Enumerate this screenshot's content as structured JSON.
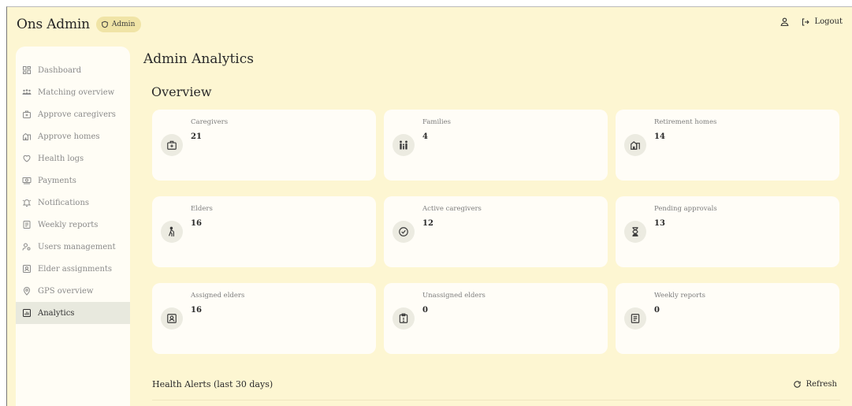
{
  "app": {
    "title": "Ons Admin",
    "role_badge": "Admin"
  },
  "topbar": {
    "logout_label": "Logout"
  },
  "sidebar": {
    "items": [
      {
        "label": "Dashboard",
        "icon": "dashboard-icon",
        "active": false
      },
      {
        "label": "Matching overview",
        "icon": "people-icon",
        "active": false
      },
      {
        "label": "Approve caregivers",
        "icon": "medical-case-icon",
        "active": false
      },
      {
        "label": "Approve homes",
        "icon": "building-icon",
        "active": false
      },
      {
        "label": "Health logs",
        "icon": "heart-icon",
        "active": false
      },
      {
        "label": "Payments",
        "icon": "banknote-icon",
        "active": false
      },
      {
        "label": "Notifications",
        "icon": "bell-icon",
        "active": false
      },
      {
        "label": "Weekly reports",
        "icon": "report-icon",
        "active": false
      },
      {
        "label": "Users management",
        "icon": "users-icon",
        "active": false
      },
      {
        "label": "Elder assignments",
        "icon": "contact-card-icon",
        "active": false
      },
      {
        "label": "GPS overview",
        "icon": "map-pin-icon",
        "active": false
      },
      {
        "label": "Analytics",
        "icon": "analytics-icon",
        "active": true
      }
    ]
  },
  "main": {
    "title": "Admin Analytics",
    "overview_title": "Overview",
    "cards": [
      {
        "label": "Caregivers",
        "value": "21",
        "icon": "medical-case-icon"
      },
      {
        "label": "Families",
        "value": "4",
        "icon": "family-icon"
      },
      {
        "label": "Retirement homes",
        "value": "14",
        "icon": "building-icon"
      },
      {
        "label": "Elders",
        "value": "16",
        "icon": "elder-walking-icon"
      },
      {
        "label": "Active caregivers",
        "value": "12",
        "icon": "check-circle-icon"
      },
      {
        "label": "Pending approvals",
        "value": "13",
        "icon": "hourglass-icon"
      },
      {
        "label": "Assigned elders",
        "value": "16",
        "icon": "contact-card-icon"
      },
      {
        "label": "Unassigned elders",
        "value": "0",
        "icon": "alert-clipboard-icon"
      },
      {
        "label": "Weekly reports",
        "value": "0",
        "icon": "report-icon"
      }
    ],
    "health_alerts_title": "Health Alerts (last 30 days)",
    "refresh_label": "Refresh"
  }
}
